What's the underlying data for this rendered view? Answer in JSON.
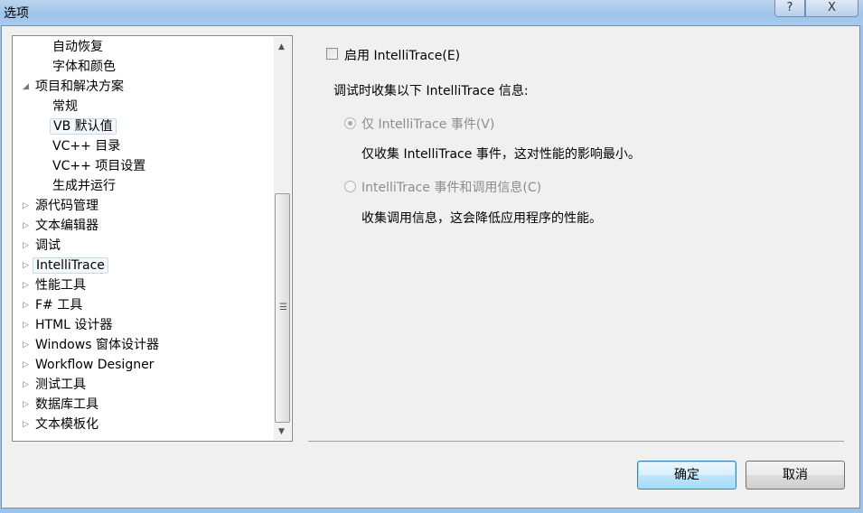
{
  "window": {
    "title": "选项",
    "help_label": "?",
    "close_label": "X"
  },
  "tree": {
    "items": [
      {
        "label": "自动恢复",
        "level": 1,
        "arrow": ""
      },
      {
        "label": "字体和颜色",
        "level": 1,
        "arrow": ""
      },
      {
        "label": "项目和解决方案",
        "level": 0,
        "arrow": "◢"
      },
      {
        "label": "常规",
        "level": 1,
        "arrow": ""
      },
      {
        "label": "VB 默认值",
        "level": 1,
        "arrow": "",
        "selected": true
      },
      {
        "label": "VC++ 目录",
        "level": 1,
        "arrow": ""
      },
      {
        "label": "VC++ 项目设置",
        "level": 1,
        "arrow": ""
      },
      {
        "label": "生成并运行",
        "level": 1,
        "arrow": ""
      },
      {
        "label": "源代码管理",
        "level": 0,
        "arrow": "▷"
      },
      {
        "label": "文本编辑器",
        "level": 0,
        "arrow": "▷"
      },
      {
        "label": "调试",
        "level": 0,
        "arrow": "▷"
      },
      {
        "label": "IntelliTrace",
        "level": 0,
        "arrow": "▷",
        "selected": true
      },
      {
        "label": "性能工具",
        "level": 0,
        "arrow": "▷"
      },
      {
        "label": "F# 工具",
        "level": 0,
        "arrow": "▷"
      },
      {
        "label": "HTML 设计器",
        "level": 0,
        "arrow": "▷"
      },
      {
        "label": "Windows 窗体设计器",
        "level": 0,
        "arrow": "▷"
      },
      {
        "label": "Workflow Designer",
        "level": 0,
        "arrow": "▷"
      },
      {
        "label": "测试工具",
        "level": 0,
        "arrow": "▷"
      },
      {
        "label": "数据库工具",
        "level": 0,
        "arrow": "▷"
      },
      {
        "label": "文本模板化",
        "level": 0,
        "arrow": "▷"
      }
    ]
  },
  "panel": {
    "enable_label": "启用 IntelliTrace(E)",
    "enable_checked": false,
    "collect_heading": "调试时收集以下 IntelliTrace 信息:",
    "option1_label": "仅 IntelliTrace 事件(V)",
    "option1_desc": "仅收集 IntelliTrace 事件，这对性能的影响最小。",
    "option2_label": "IntelliTrace 事件和调用信息(C)",
    "option2_desc": "收集调用信息，这会降低应用程序的性能。",
    "selected_option": 1
  },
  "buttons": {
    "ok": "确定",
    "cancel": "取消"
  }
}
